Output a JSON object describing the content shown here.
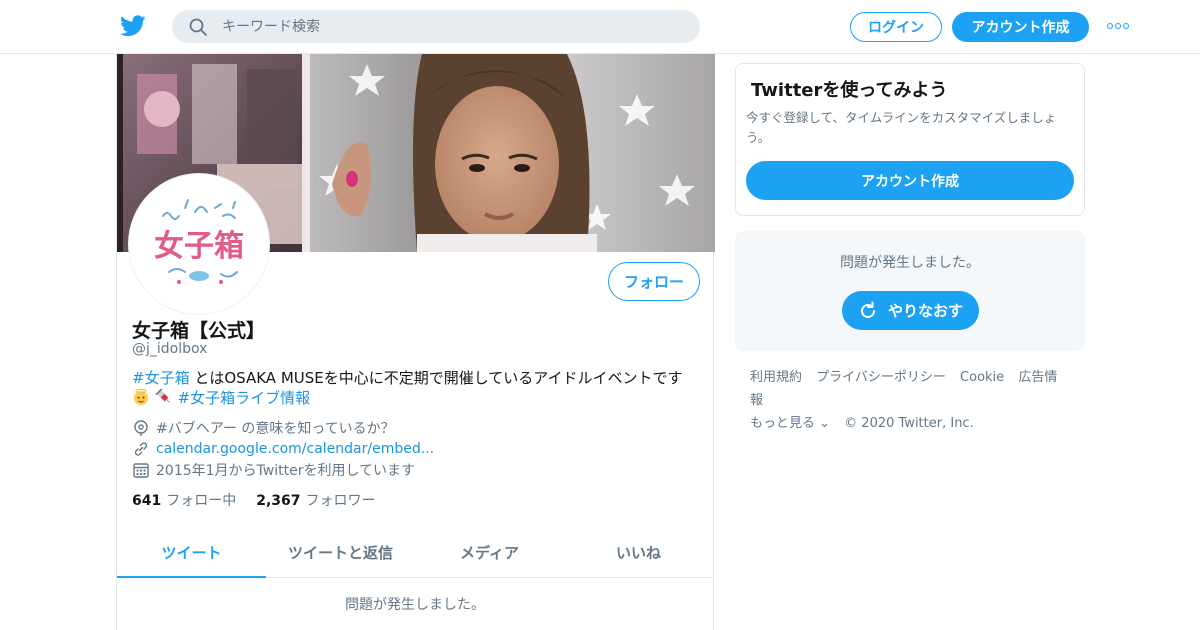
{
  "header": {
    "logo_icon": "twitter-bird-icon",
    "search_placeholder": "キーワード検索",
    "search_icon": "search-icon",
    "login_label": "ログイン",
    "signup_label": "アカウント作成",
    "more_icon": "more-dots-icon"
  },
  "profile": {
    "follow_label": "フォロー",
    "name": "女子箱【公式】",
    "handle": "@j_idolbox",
    "avatar_logo_text": "女子箱",
    "bio": {
      "hashtag1": "#女子箱",
      "text": " とはOSAKA MUSEを中心に不定期で開催しているアイドルイベントです",
      "emoji1": "baby-angel-emoji",
      "emoji2": "syringe-emoji",
      "hashtag2": "#女子箱ライブ情報"
    },
    "location": "#バブヘアー の意味を知っているか？",
    "url": "calendar.google.com/calendar/embed...",
    "joined": "2015年1月からTwitterを利用しています",
    "following_count": "641",
    "following_label": "フォロー中",
    "followers_count": "2,367",
    "followers_label": "フォロワー"
  },
  "tabs": [
    {
      "label": "ツイート",
      "active": true
    },
    {
      "label": "ツイートと返信",
      "active": false
    },
    {
      "label": "メディア",
      "active": false
    },
    {
      "label": "いいね",
      "active": false
    }
  ],
  "timeline": {
    "error": "問題が発生しました。"
  },
  "sidebar": {
    "promo_title": "Twitterを使ってみよう",
    "promo_text": "今すぐ登録して、タイムラインをカスタマイズしましょう。",
    "promo_button": "アカウント作成",
    "error_text": "問題が発生しました。",
    "retry_label": "やりなおす"
  },
  "footer": {
    "links": [
      "利用規約",
      "プライバシーポリシー",
      "Cookie",
      "広告情報",
      "もっと見る ⌄"
    ],
    "copyright": "© 2020 Twitter, Inc."
  },
  "colors": {
    "accent": "#1da1f2",
    "link": "#1b95e0",
    "muted": "#657786",
    "border": "#e1e8ed"
  }
}
